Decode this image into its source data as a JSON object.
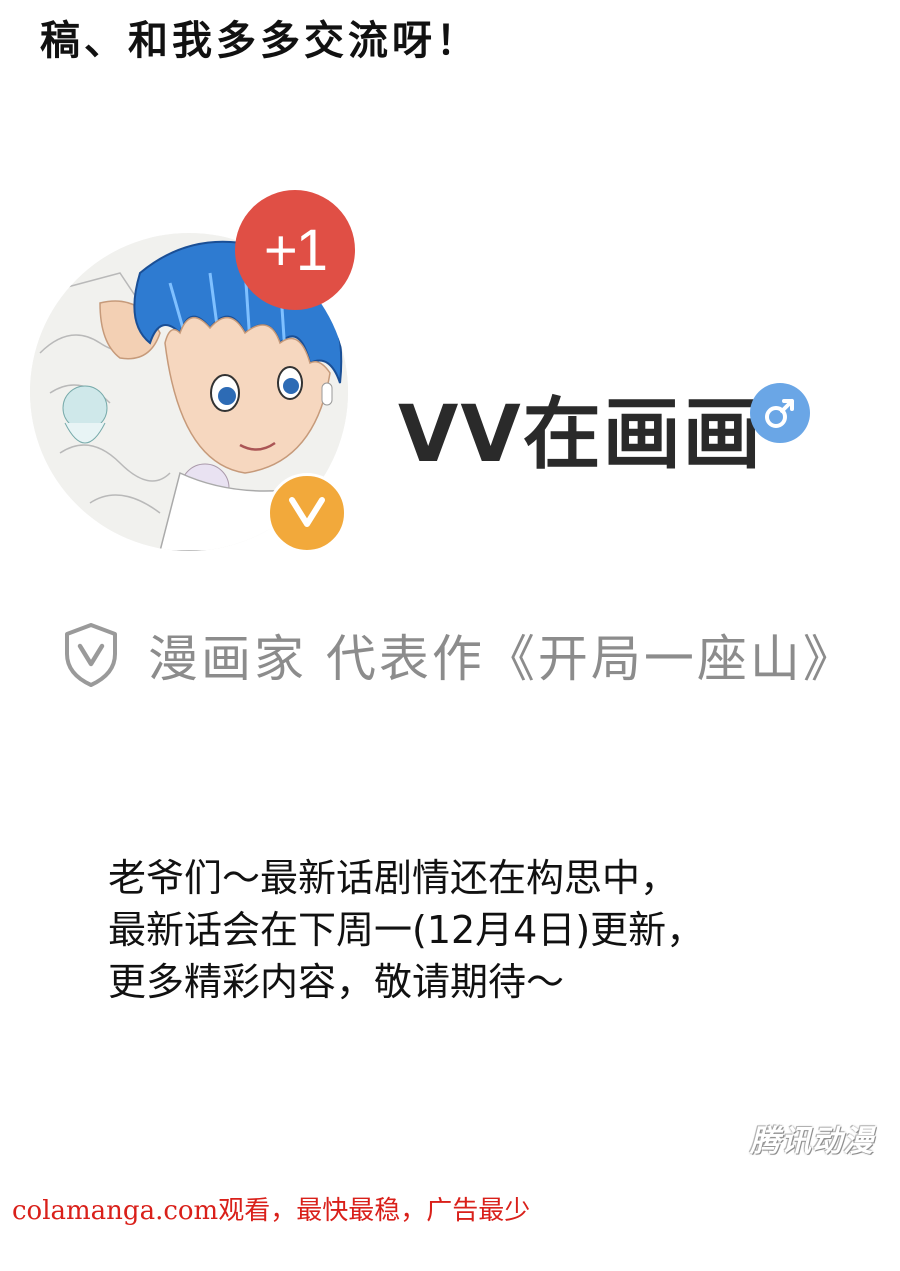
{
  "top_text": "稿、和我多多交流呀！",
  "profile": {
    "badge_count": "+1",
    "username": "VV在画画",
    "verified_badge_letter": "V",
    "gender": "male",
    "verification_text": "漫画家 代表作《开局一座山》"
  },
  "notice": {
    "lines": [
      "老爷们～最新话剧情还在构思中，",
      "最新话会在下周一(12月4日)更新，",
      "更多精彩内容，敬请期待～"
    ]
  },
  "watermark": "腾讯动漫",
  "footer": "colamanga.com观看，最快最稳，广告最少",
  "colors": {
    "badge_red": "#e04f45",
    "badge_orange": "#f2a93b",
    "gender_blue": "#6aa6e6",
    "footer_red": "#d9201a",
    "verify_gray": "#8c8c8c"
  }
}
